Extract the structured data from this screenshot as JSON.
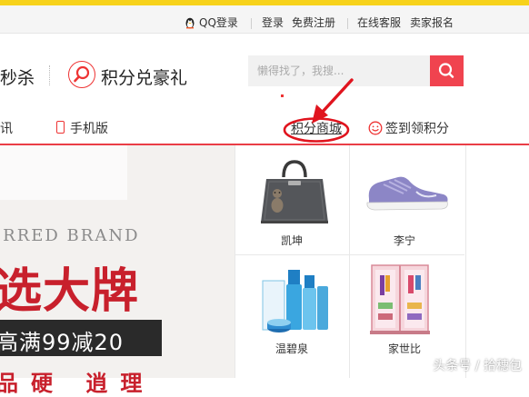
{
  "top_bar": {
    "qq_login": "QQ登录",
    "login": "登录",
    "free_register": "免费注册",
    "online_service": "在线客服",
    "seller_signup": "卖家报名"
  },
  "header": {
    "flash_sale": "秒杀",
    "points_exchange": "积分兑豪礼",
    "search_placeholder": "懒得找了，我搜..."
  },
  "nav": {
    "news_partial": "讯",
    "mobile": "手机版",
    "points_mall": "积分商城",
    "sign_in_points": "签到领积分"
  },
  "banner": {
    "brand_en": "ERRED BRAND",
    "title": "选大牌",
    "promo": "高满99减20",
    "bottom": "品硬 逍理"
  },
  "products": [
    {
      "name": "凯坤"
    },
    {
      "name": "李宁"
    },
    {
      "name": "温碧泉"
    },
    {
      "name": "家世比"
    }
  ],
  "watermark": "头条号 / 拾穗包",
  "colors": {
    "accent": "#ea3d46",
    "search_button": "#f0434f",
    "top_stripe": "#f7d21b",
    "annotation": "#e0141e"
  }
}
